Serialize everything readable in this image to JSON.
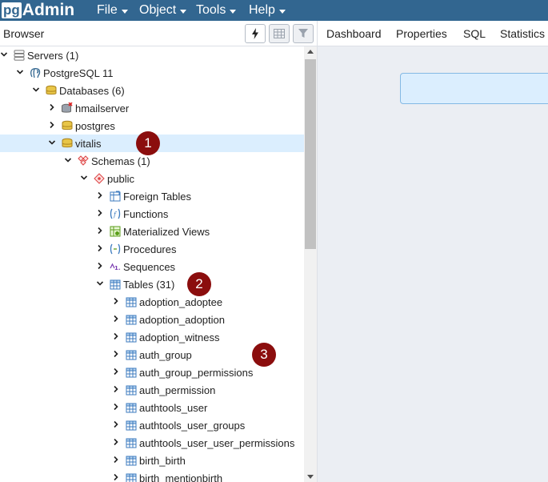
{
  "navbar": {
    "logo_pg": "pg",
    "logo_admin": "Admin",
    "menus": [
      "File",
      "Object",
      "Tools",
      "Help"
    ]
  },
  "browser": {
    "title": "Browser",
    "toolbar": {
      "query_tool": "lightning-icon",
      "view_data": "table-grid-icon",
      "filter": "filter-icon"
    }
  },
  "tabs": [
    "Dashboard",
    "Properties",
    "SQL",
    "Statistics"
  ],
  "tree": [
    {
      "label": "Servers (1)",
      "type": "servers",
      "toggle": "open",
      "depth": 0
    },
    {
      "label": "PostgreSQL 11",
      "type": "server",
      "toggle": "open",
      "depth": 1
    },
    {
      "label": "Databases (6)",
      "type": "databases",
      "toggle": "open",
      "depth": 2
    },
    {
      "label": "hmailserver",
      "type": "database-disconnected",
      "toggle": "closed",
      "depth": 3
    },
    {
      "label": "postgres",
      "type": "database",
      "toggle": "closed",
      "depth": 3
    },
    {
      "label": "vitalis",
      "type": "database",
      "toggle": "open",
      "depth": 3,
      "selected": true
    },
    {
      "label": "Schemas (1)",
      "type": "schemas",
      "toggle": "open",
      "depth": 4
    },
    {
      "label": "public",
      "type": "schema",
      "toggle": "open",
      "depth": 5
    },
    {
      "label": "Foreign Tables",
      "type": "foreign-tables",
      "toggle": "closed",
      "depth": 6
    },
    {
      "label": "Functions",
      "type": "functions",
      "toggle": "closed",
      "depth": 6
    },
    {
      "label": "Materialized Views",
      "type": "mviews",
      "toggle": "closed",
      "depth": 6
    },
    {
      "label": "Procedures",
      "type": "procedures",
      "toggle": "closed",
      "depth": 6
    },
    {
      "label": "Sequences",
      "type": "sequences",
      "toggle": "closed",
      "depth": 6
    },
    {
      "label": "Tables (31)",
      "type": "tables",
      "toggle": "open",
      "depth": 6
    },
    {
      "label": "adoption_adoptee",
      "type": "table",
      "toggle": "closed",
      "depth": 7
    },
    {
      "label": "adoption_adoption",
      "type": "table",
      "toggle": "closed",
      "depth": 7
    },
    {
      "label": "adoption_witness",
      "type": "table",
      "toggle": "closed",
      "depth": 7
    },
    {
      "label": "auth_group",
      "type": "table",
      "toggle": "closed",
      "depth": 7
    },
    {
      "label": "auth_group_permissions",
      "type": "table",
      "toggle": "closed",
      "depth": 7
    },
    {
      "label": "auth_permission",
      "type": "table",
      "toggle": "closed",
      "depth": 7
    },
    {
      "label": "authtools_user",
      "type": "table",
      "toggle": "closed",
      "depth": 7
    },
    {
      "label": "authtools_user_groups",
      "type": "table",
      "toggle": "closed",
      "depth": 7
    },
    {
      "label": "authtools_user_user_permissions",
      "type": "table",
      "toggle": "closed",
      "depth": 7
    },
    {
      "label": "birth_birth",
      "type": "table",
      "toggle": "closed",
      "depth": 7
    },
    {
      "label": "birth_mentionbirth",
      "type": "table",
      "toggle": "closed",
      "depth": 7
    }
  ],
  "sequences_glyph": "1.3",
  "annotations": [
    {
      "number": "1",
      "row": 5
    },
    {
      "number": "2",
      "row": 13
    },
    {
      "number": "3",
      "row": 17
    }
  ],
  "colors": {
    "navbar": "#326690",
    "selection": "#dbeefe",
    "badge": "#8b0d0d"
  }
}
